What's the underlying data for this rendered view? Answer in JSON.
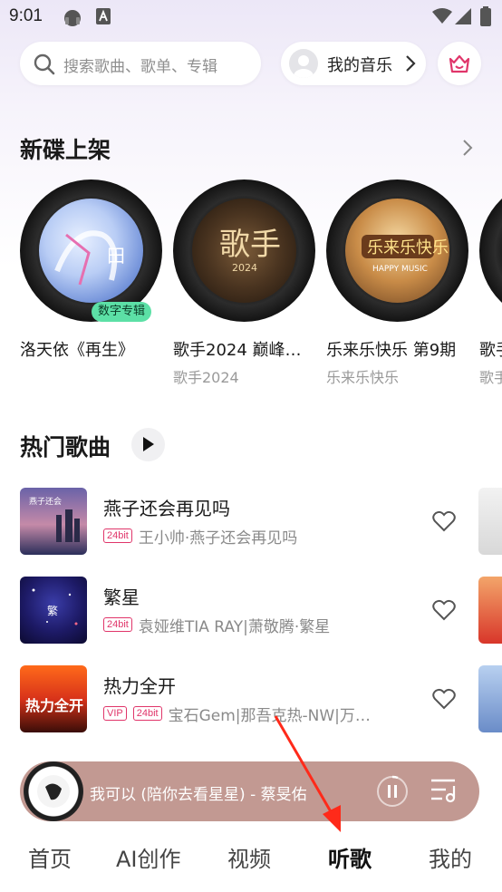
{
  "status_bar": {
    "time": "9:01"
  },
  "header": {
    "search_placeholder": "搜索歌曲、歌单、专辑",
    "my_music_label": "我的音乐"
  },
  "new_albums": {
    "title": "新碟上架",
    "items": [
      {
        "title": "洛天依《再生》",
        "subtitle": "",
        "badge": "数字专辑"
      },
      {
        "title": "歌手2024 巅峰…",
        "subtitle": "歌手2024"
      },
      {
        "title": "乐来乐快乐 第9期",
        "subtitle": "乐来乐快乐"
      },
      {
        "title": "歌手",
        "subtitle": "歌手"
      }
    ]
  },
  "hot_songs": {
    "title": "热门歌曲",
    "items": [
      {
        "name": "燕子还会再见吗",
        "tags": [
          "24bit"
        ],
        "artist": "王小帅·燕子还会再见吗"
      },
      {
        "name": "繁星",
        "tags": [
          "24bit"
        ],
        "artist": "袁娅维TIA RAY|萧敬腾·繁星"
      },
      {
        "name": "热力全开",
        "tags": [
          "VIP",
          "24bit"
        ],
        "artist": "宝石Gem|那吾克热-NW|万…"
      }
    ]
  },
  "player": {
    "now_playing": "我可以 (陪你去看星星) - 蔡旻佑"
  },
  "bottom_nav": {
    "items": [
      "首页",
      "AI创作",
      "视频",
      "听歌",
      "我的"
    ],
    "active_index": 3
  },
  "colors": {
    "accent": "#e0356a",
    "badge": "#5ce0a6",
    "player_bg": "#c29992",
    "arrow": "#ff2a1a"
  }
}
